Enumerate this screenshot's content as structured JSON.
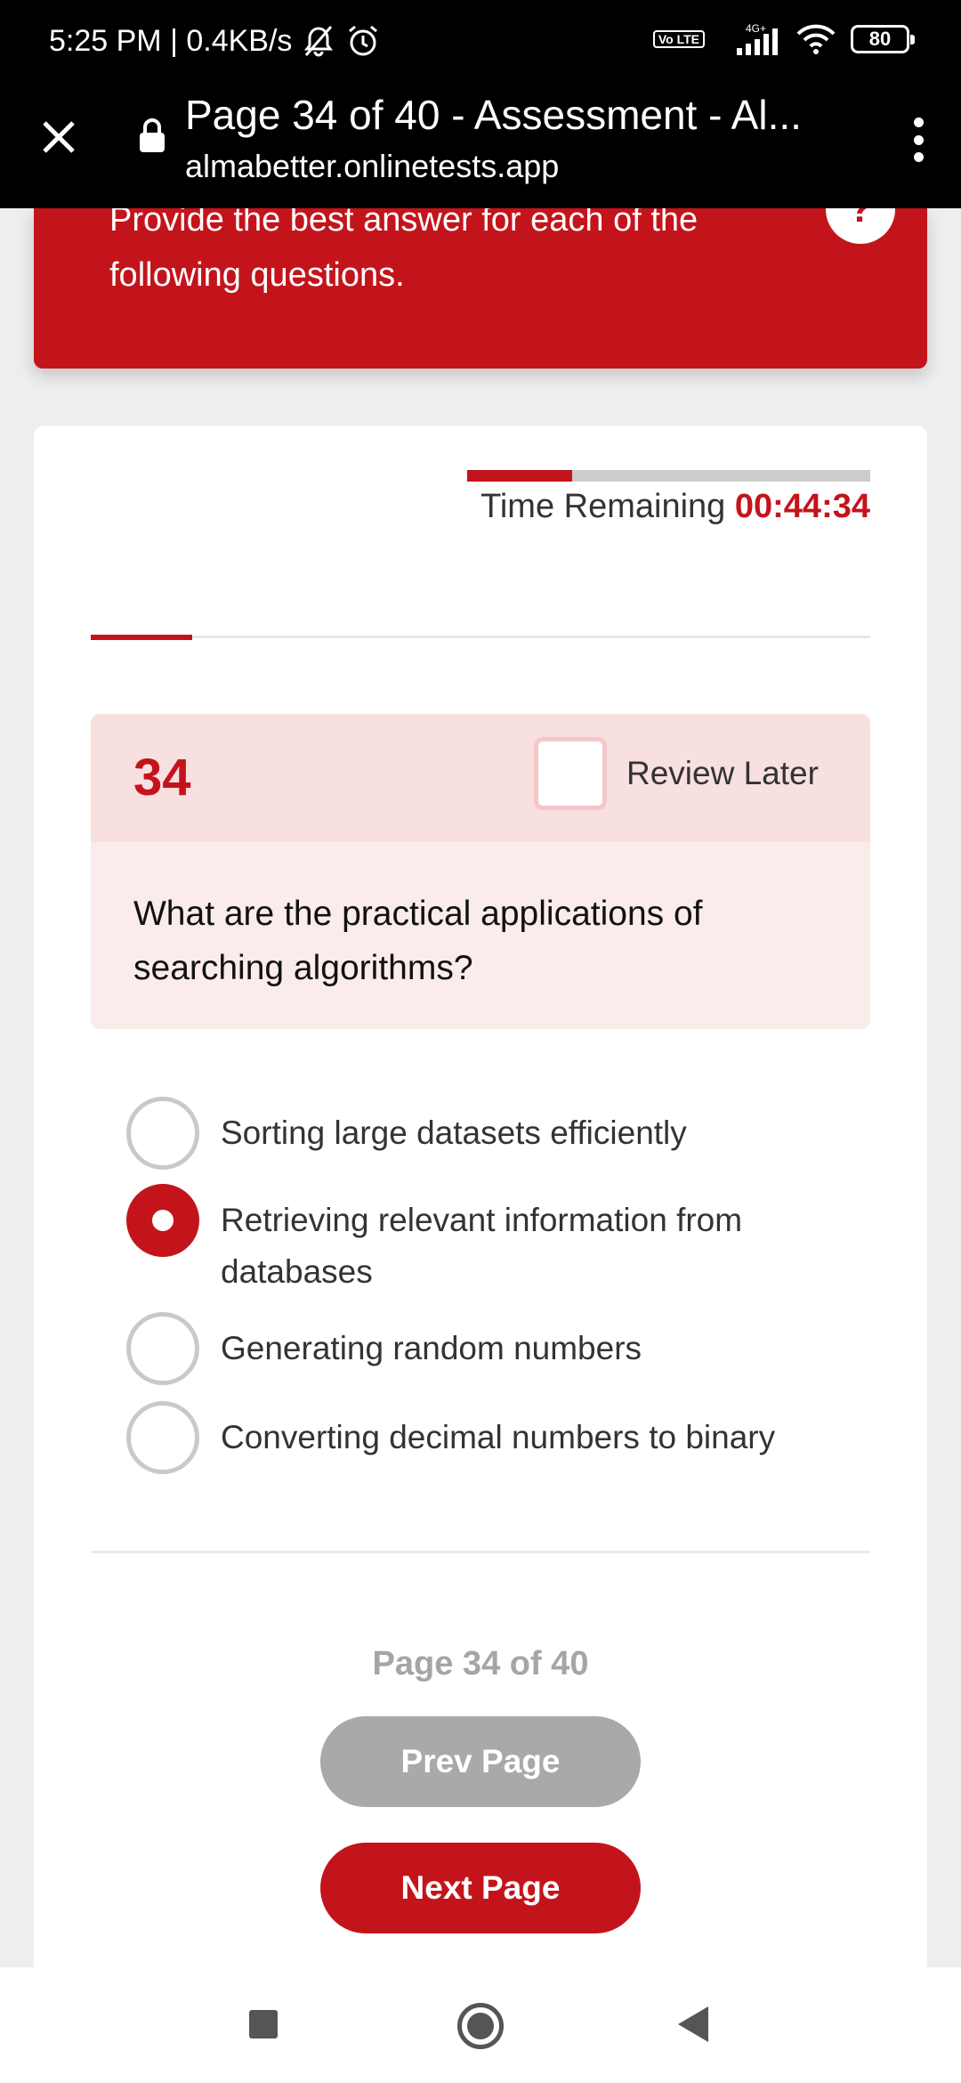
{
  "status_bar": {
    "time_speed": "5:25 PM | 0.4KB/s",
    "network_badge": "Vo LTE",
    "network_type": "4G+",
    "battery": "80",
    "icons": [
      "mute-icon",
      "alarm-icon",
      "volte-icon",
      "signal-icon",
      "wifi-icon",
      "battery-icon"
    ]
  },
  "browser": {
    "title": "Page 34 of 40 - Assessment - Al...",
    "url": "almabetter.onlinetests.app"
  },
  "banner": {
    "instructions": "Provide the best answer for each of the following questions.",
    "help_label": "?"
  },
  "timer": {
    "label": "Time Remaining",
    "value": "00:44:34",
    "elapsed_fraction": 0.26
  },
  "progress": {
    "fraction": 0.13
  },
  "question": {
    "number": "34",
    "review_label": "Review Later",
    "review_checked": false,
    "text": "What are the practical applications of searching algorithms?",
    "options": [
      {
        "label": "Sorting large datasets efficiently",
        "selected": false
      },
      {
        "label": "Retrieving relevant information from databases",
        "selected": true
      },
      {
        "label": "Generating random numbers",
        "selected": false
      },
      {
        "label": "Converting decimal numbers to binary",
        "selected": false
      }
    ]
  },
  "pagination": {
    "indicator": "Page 34 of 40",
    "prev_label": "Prev Page",
    "next_label": "Next Page"
  },
  "colors": {
    "accent": "#c4141b",
    "question_header": "#f8dfe0",
    "question_body": "#fbecec",
    "disabled_button": "#a9a9a9"
  }
}
